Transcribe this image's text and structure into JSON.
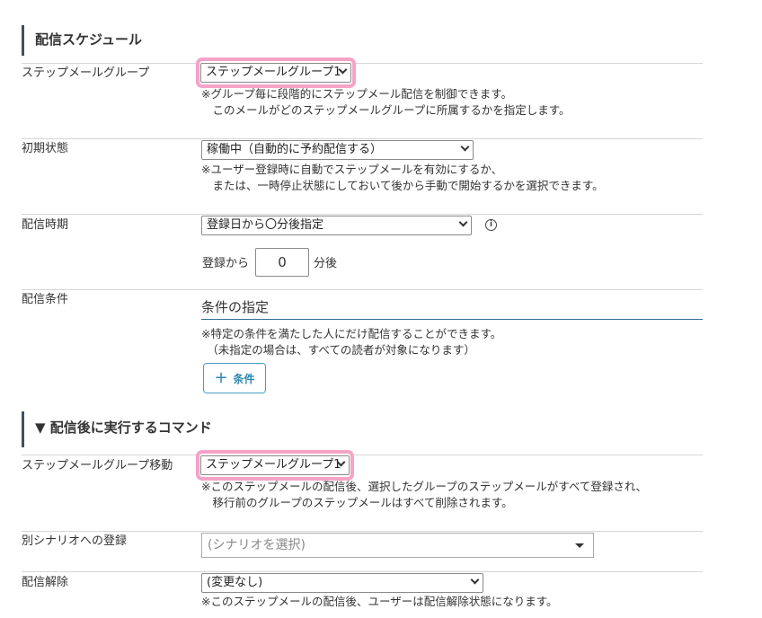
{
  "schedule": {
    "heading": "配信スケジュール",
    "group": {
      "label": "ステップメールグループ",
      "selected": "ステップメールグループ1",
      "note": "※グループ毎に段階的にステップメール配信を制御できます。\n　このメールがどのステップメールグループに所属するかを指定します。"
    },
    "initial": {
      "label": "初期状態",
      "selected": "稼働中（自動的に予約配信する）",
      "note": "※ユーザー登録時に自動でステップメールを有効にするか、\n　または、一時停止状態にしておいて後から手動で開始するかを選択できます。"
    },
    "timing": {
      "label": "配信時期",
      "selected": "登録日から〇分後指定",
      "info_icon": "info-icon",
      "prefix": "登録から",
      "minutes": "0",
      "suffix": "分後"
    },
    "condition": {
      "label": "配信条件",
      "title": "条件の指定",
      "note": "※特定の条件を満たした人にだけ配信することができます。\n　（未指定の場合は、すべての読者が対象になります）",
      "add_button": "条件",
      "add_icon": "plus-icon"
    }
  },
  "commands": {
    "heading": "▼ 配信後に実行するコマンド",
    "move": {
      "label": "ステップメールグループ移動",
      "selected": "ステップメールグループ1",
      "note": "※このステップメールの配信後、選択したグループのステップメールがすべて登録され、\n　移行前のグループのステップメールはすべて削除されます。"
    },
    "scenario": {
      "label": "別シナリオへの登録",
      "placeholder": "(シナリオを選択)"
    },
    "unsubscribe": {
      "label": "配信解除",
      "selected": "(変更なし)",
      "note": "※このステップメールの配信後、ユーザーは配信解除状態になります。"
    }
  },
  "colors": {
    "highlight": "#f5a3c7",
    "accent": "#2b86b0",
    "heading_bar": "#3b5266"
  }
}
